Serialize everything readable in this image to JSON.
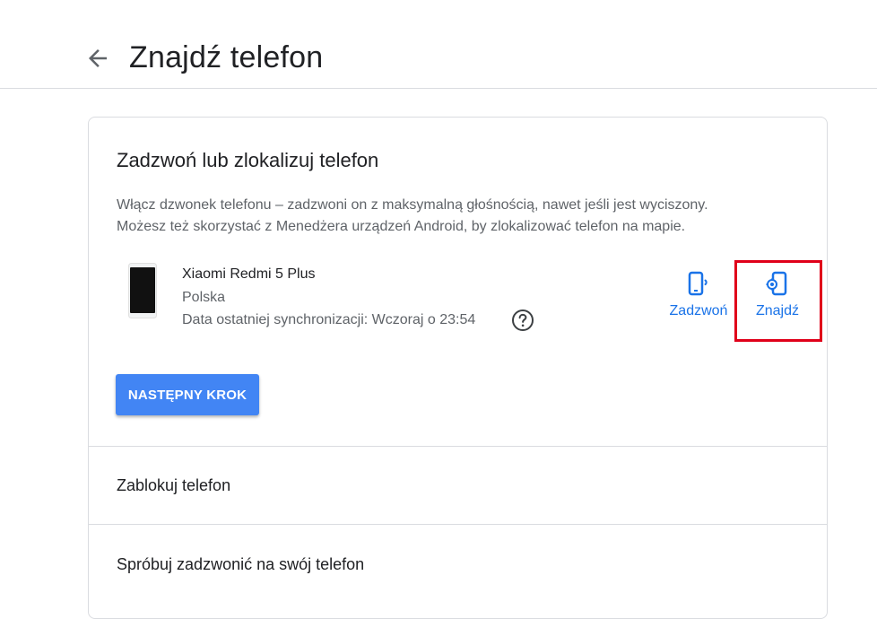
{
  "header": {
    "title": "Znajdź telefon",
    "back_icon": "arrow-left-icon"
  },
  "card": {
    "title": "Zadzwoń lub zlokalizuj telefon",
    "description_line1": "Włącz dzwonek telefonu – zadzwoni on z maksymalną głośnością, nawet jeśli jest wyciszony.",
    "description_line2": "Możesz też skorzystać z Menedżera urządzeń Android, by zlokalizować telefon na mapie.",
    "device": {
      "name": "Xiaomi Redmi 5 Plus",
      "country": "Polska",
      "last_sync": "Data ostatniej synchronizacji: Wczoraj o 23:54",
      "help_icon": "help-circle-icon"
    },
    "actions": {
      "call_label": "Zadzwoń",
      "call_icon": "phone-ring-icon",
      "find_label": "Znajdź",
      "find_icon": "phone-locate-icon"
    },
    "next_button_label": "NASTĘPNY KROK"
  },
  "sections": [
    {
      "label": "Zablokuj telefon"
    },
    {
      "label": "Spróbuj zadzwonić na swój telefon"
    }
  ],
  "colors": {
    "accent": "#1a73e8",
    "button": "#4285f4",
    "highlight": "#e0001a"
  }
}
